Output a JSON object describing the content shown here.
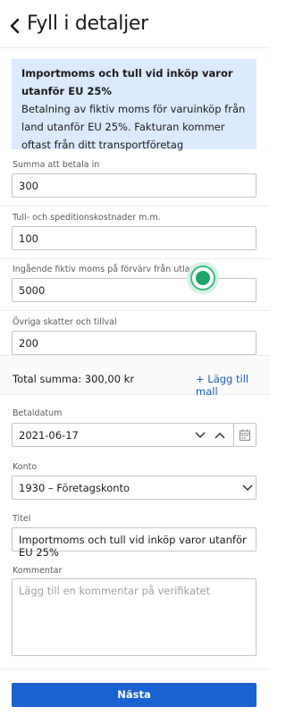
{
  "header": {
    "title": "Fyll i detaljer"
  },
  "info": {
    "title": "Importmoms och tull vid inköp varor utanför EU 25%",
    "body": "Betalning av fiktiv moms för varuinköp från land utanför EU 25%. Fakturan kommer oftast från ditt transportföretag"
  },
  "fields": [
    {
      "label": "Summa att betala in",
      "value": "300"
    },
    {
      "label": "Tull- och speditionskostnader m.m.",
      "value": "100"
    },
    {
      "label": "Ingående fiktiv moms på förvärv från utlandet",
      "value": "5000"
    },
    {
      "label": "Övriga skatter och tillval",
      "value": "200"
    }
  ],
  "summary": {
    "total": "Total summa: 300,00 kr",
    "add_template": "+ Lägg till mall"
  },
  "payment_date": {
    "label": "Betaldatum",
    "value": "2021-06-17"
  },
  "account": {
    "label": "Konto",
    "value": "1930 – Företagskonto"
  },
  "title_field": {
    "label": "Titel",
    "value": "Importmoms och tull vid inköp varor utanför EU 25%"
  },
  "comment": {
    "label": "Kommentar",
    "placeholder": "Lägg till en kommentar på verifikatet"
  },
  "next_button": "Nästa",
  "colors": {
    "accent": "#1a62cf",
    "info_bg": "#dbeafc",
    "focus": "#1ea46b"
  }
}
